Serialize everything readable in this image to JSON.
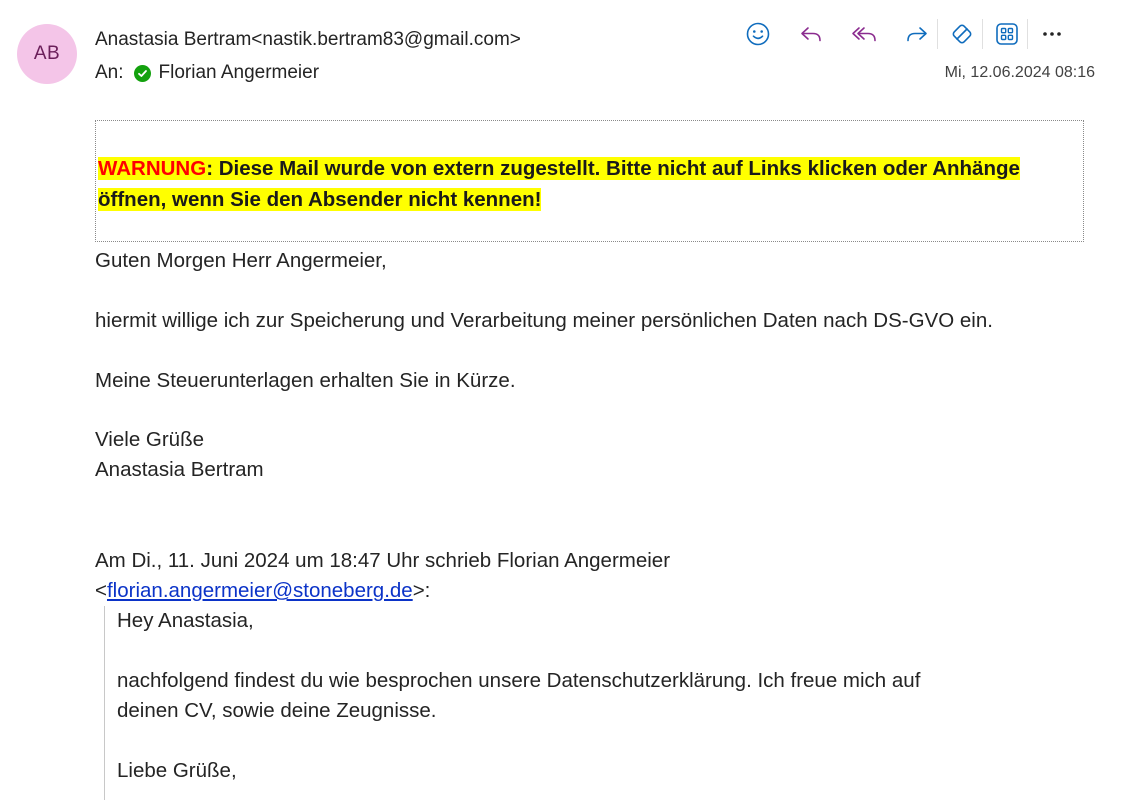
{
  "sender": {
    "initials": "AB",
    "name": "Anastasia Bertram",
    "email": "nastik.bertram83@gmail.com"
  },
  "recipients": {
    "label": "An:",
    "name": "Florian Angermeier"
  },
  "date": "Mi, 12.06.2024 08:16",
  "toolbar": {
    "icons": [
      "emoji-icon",
      "reply-icon",
      "reply-all-icon",
      "forward-icon",
      "immersive-reader-icon",
      "apps-icon",
      "more-icon"
    ]
  },
  "warning": {
    "label": "WARNUNG",
    "text": ": Diese Mail wurde von extern zugestellt. Bitte nicht auf Links klicken oder Anhänge öffnen, wenn Sie den Absender nicht kennen!"
  },
  "body": {
    "greeting": "Guten Morgen Herr Angermeier,",
    "paragraph1": "hiermit willige ich zur Speicherung und Verarbeitung meiner persönlichen Daten nach DS-GVO ein.",
    "paragraph2": "Meine Steuerunterlagen erhalten Sie in Kürze.",
    "closing": "Viele Grüße",
    "signature": "Anastasia Bertram"
  },
  "quoted": {
    "intro": "Am Di., 11. Juni 2024 um 18:47 Uhr schrieb Florian Angermeier",
    "email": "florian.angermeier@stoneberg.de",
    "greeting": "Hey Anastasia,",
    "paragraph_line1": "nachfolgend findest du wie besprochen unsere Datenschutzerklärung. Ich freue mich auf",
    "paragraph_line2": "deinen CV, sowie deine Zeugnisse.",
    "closing": "Liebe Grüße,"
  },
  "colors": {
    "avatar_bg": "#f4c5e8",
    "icon_accent": "#0f6cbd",
    "reply_accent": "#8b2c8f",
    "highlight": "#ffff00",
    "warning_red": "#ff0000",
    "link": "#0b33c8"
  }
}
